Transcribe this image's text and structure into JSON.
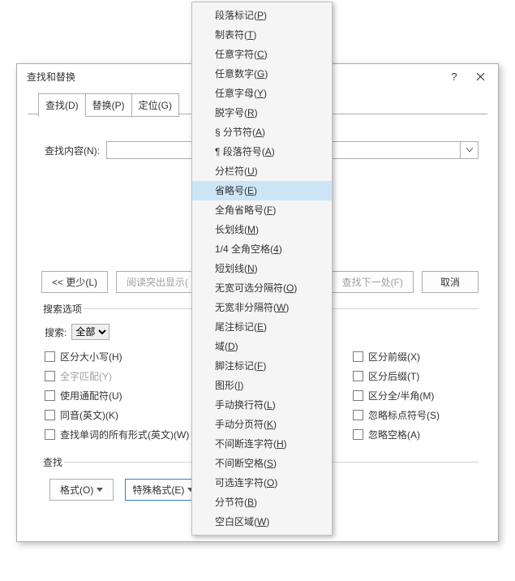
{
  "dialog": {
    "title": "查找和替换",
    "help": "?",
    "close": "✕"
  },
  "tabs": [
    {
      "label": "查找(D)"
    },
    {
      "label": "替换(P)"
    },
    {
      "label": "定位(G)"
    }
  ],
  "find": {
    "label": "查找内容(N):",
    "value": ""
  },
  "buttons": {
    "less": "<< 更少(L)",
    "highlight": "阅读突出显示(",
    "findnext": "查找下一处(F)",
    "cancel": "取消",
    "format": "格式(O)",
    "special": "特殊格式(E)"
  },
  "options": {
    "legend": "搜索选项",
    "search_label": "搜索:",
    "search_value": "全部",
    "colA": [
      "区分大小写(H)",
      "全字匹配(Y)",
      "使用通配符(U)",
      "同音(英文)(K)",
      "查找单词的所有形式(英文)(W)"
    ],
    "colB": [
      "区分前缀(X)",
      "区分后缀(T)",
      "区分全/半角(M)",
      "忽略标点符号(S)",
      "忽略空格(A)"
    ]
  },
  "findsec": {
    "legend": "查找"
  },
  "menu": {
    "hl_index": 9,
    "items": [
      "段落标记(P)",
      "制表符(T)",
      "任意字符(C)",
      "任意数字(G)",
      "任意字母(Y)",
      "脱字号(R)",
      "§ 分节符(A)",
      "¶ 段落符号(A)",
      "分栏符(U)",
      "省略号(E)",
      "全角省略号(F)",
      "长划线(M)",
      "1/4 全角空格(4)",
      "短划线(N)",
      "无宽可选分隔符(O)",
      "无宽非分隔符(W)",
      "尾注标记(E)",
      "域(D)",
      "脚注标记(F)",
      "图形(I)",
      "手动换行符(L)",
      "手动分页符(K)",
      "不间断连字符(H)",
      "不间断空格(S)",
      "可选连字符(O)",
      "分节符(B)",
      "空白区域(W)"
    ]
  }
}
